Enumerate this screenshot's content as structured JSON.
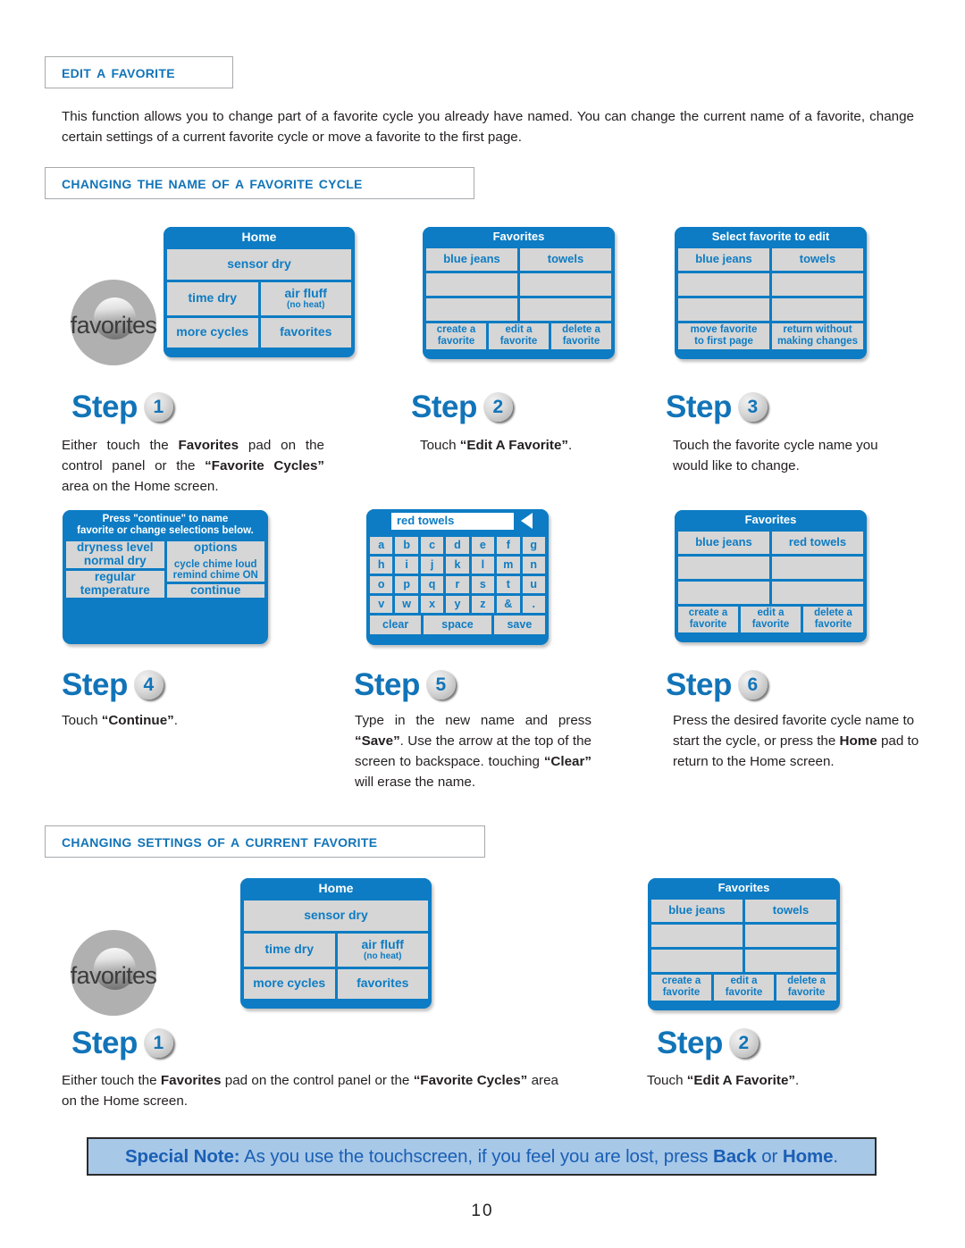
{
  "page": {
    "number": "10"
  },
  "headings": {
    "edit_a_favorite": "Edit a Favorite",
    "changing_name": "Changing the Name of a Favorite Cycle",
    "changing_settings": "Changing Settings of a Current Favorite"
  },
  "intro": "This function allows you to change part of a favorite cycle you already have named. You can change the current name of a favorite, change certain settings of a current favorite cycle or move a favorite to the first page.",
  "knob_label": "favorites",
  "steps": {
    "word": "Step",
    "s1": {
      "num": "1"
    },
    "s2": {
      "num": "2"
    },
    "s3": {
      "num": "3"
    },
    "s4": {
      "num": "4"
    },
    "s5": {
      "num": "5"
    },
    "s6": {
      "num": "6"
    }
  },
  "screens": {
    "home": {
      "title": "Home",
      "sensor_dry": "sensor dry",
      "time_dry": "time dry",
      "air_fluff": "air fluff",
      "air_fluff_sub": "(no heat)",
      "more_cycles": "more cycles",
      "favorites": "favorites"
    },
    "favorites": {
      "title": "Favorites",
      "blue_jeans": "blue jeans",
      "towels": "towels",
      "red_towels": "red towels",
      "create": "create a\nfavorite",
      "create_l1": "create a",
      "create_l2": "favorite",
      "edit_l1": "edit a",
      "edit_l2": "favorite",
      "delete_l1": "delete a",
      "delete_l2": "favorite"
    },
    "select_favorite": {
      "title": "Select favorite to edit",
      "blue_jeans": "blue jeans",
      "towels": "towels",
      "move_l1": "move favorite",
      "move_l2": "to first page",
      "return_l1": "return without",
      "return_l2": "making changes"
    },
    "continue_screen": {
      "title_l1": "Press \"continue\" to name",
      "title_l2": "favorite or change selections below.",
      "dryness_l1": "dryness level",
      "dryness_l2": "normal dry",
      "options": "options",
      "chime_l1": "cycle chime loud",
      "chime_l2": "remind chime ON",
      "temp_l1": "regular",
      "temp_l2": "temperature",
      "continue": "continue"
    },
    "keyboard": {
      "value": "red towels",
      "rows": [
        [
          "a",
          "b",
          "c",
          "d",
          "e",
          "f",
          "g"
        ],
        [
          "h",
          "i",
          "j",
          "k",
          "l",
          "m",
          "n"
        ],
        [
          "o",
          "p",
          "q",
          "r",
          "s",
          "t",
          "u"
        ],
        [
          "v",
          "w",
          "x",
          "y",
          "z",
          "&",
          "."
        ]
      ],
      "clear": "clear",
      "space": "space",
      "save": "save"
    }
  },
  "step_text": {
    "s1_html": "Either touch the <b>Favorites</b> pad on the control panel or the <b>&ldquo;Favorite Cycles&rdquo;</b> area on the Home screen.",
    "s2_html": "Touch <b>&ldquo;Edit A Favorite&rdquo;</b>.",
    "s3_html": "Touch the favorite cycle name you would like to change.",
    "s4_html": "Touch <b>&ldquo;Continue&rdquo;</b>.",
    "s5_html": "Type in the new name and press <b>&ldquo;Save&rdquo;</b>. Use the arrow at the top of the screen to backspace. touching <b>&ldquo;Clear&rdquo;</b> will erase the name.",
    "s6_html": "Press the desired favorite cycle name to start the cycle, or press the <b>Home</b> pad to return to the Home screen.",
    "b1_html": "Either touch the <b>Favorites</b> pad on the control panel or the <b>&ldquo;Favorite Cycles&rdquo;</b> area on the Home screen.",
    "b2_html": "Touch <b>&ldquo;Edit A Favorite&rdquo;</b>."
  },
  "special_note": {
    "label": "Special Note:",
    "text_1": " As you use the touchscreen, if you feel you are lost, press ",
    "back": "Back",
    "text_2": " or ",
    "home": "Home",
    "text_3": "."
  },
  "colors": {
    "brand_blue": "#0d7cc4",
    "heading_blue": "#1274b8",
    "screen_gray": "#d6d6d6",
    "note_bg": "#a8c8e8"
  }
}
